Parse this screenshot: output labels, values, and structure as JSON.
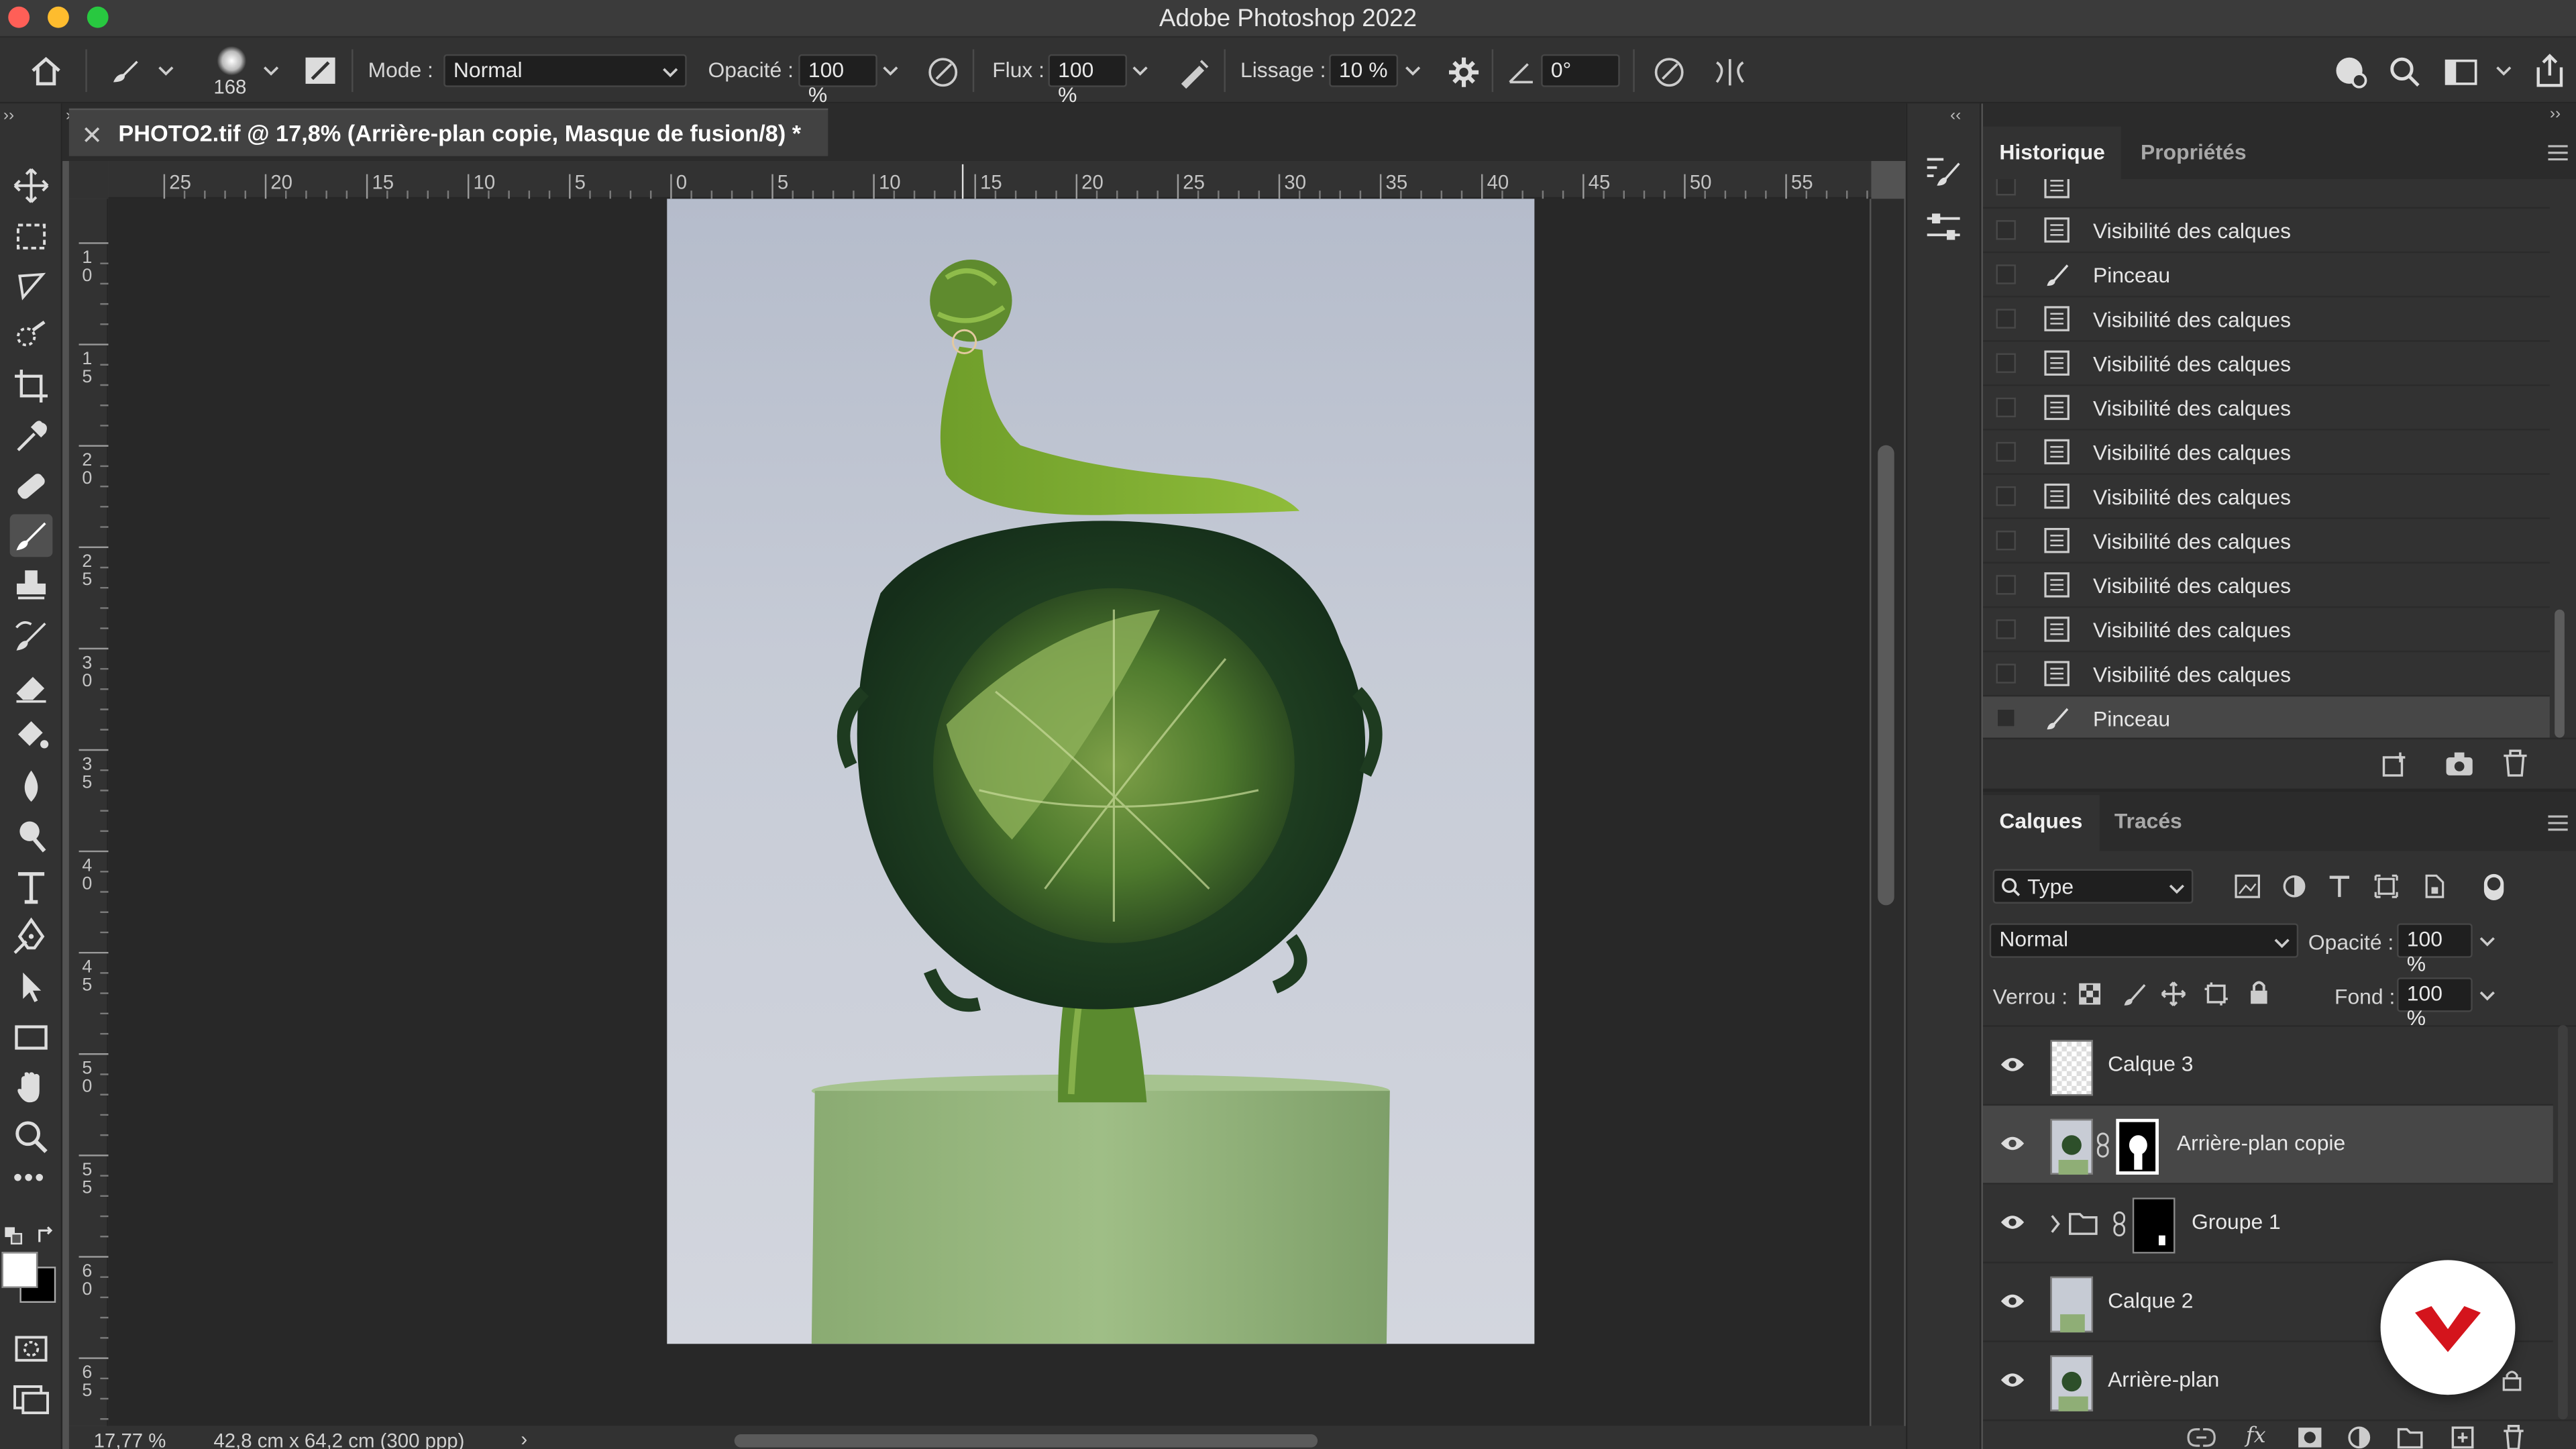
{
  "window": {
    "title": "Adobe Photoshop 2022"
  },
  "options_bar": {
    "brush_size": "168",
    "mode_label": "Mode :",
    "mode_value": "Normal",
    "opacity_label": "Opacité :",
    "opacity_value": "100 %",
    "flow_label": "Flux :",
    "flow_value": "100 %",
    "smoothing_label": "Lissage :",
    "smoothing_value": "10 %",
    "angle_value": "0°"
  },
  "document": {
    "tab_title": "PHOTO2.tif @ 17,8% (Arrière-plan copie, Masque de fusion/8) *",
    "zoom": "17,77 %",
    "dimensions": "42,8 cm x 64,2 cm (300 ppp)"
  },
  "rulers": {
    "h_labels": [
      "25",
      "20",
      "15",
      "10",
      "5",
      "0",
      "5",
      "10",
      "15",
      "20",
      "25",
      "30",
      "35",
      "40",
      "45",
      "50",
      "55"
    ],
    "v_labels": [
      "1\n0",
      "1\n5",
      "2\n0",
      "2\n5",
      "3\n0",
      "3\n5",
      "4\n0",
      "4\n5",
      "5\n0",
      "5\n5",
      "6\n0",
      "6\n5"
    ]
  },
  "history_panel": {
    "tabs": [
      "Historique",
      "Propriétés"
    ],
    "items": [
      {
        "label": "Visibilité des calques",
        "icon": "document-icon"
      },
      {
        "label": "Pinceau",
        "icon": "brush-icon"
      },
      {
        "label": "Visibilité des calques",
        "icon": "document-icon"
      },
      {
        "label": "Visibilité des calques",
        "icon": "document-icon"
      },
      {
        "label": "Visibilité des calques",
        "icon": "document-icon"
      },
      {
        "label": "Visibilité des calques",
        "icon": "document-icon"
      },
      {
        "label": "Visibilité des calques",
        "icon": "document-icon"
      },
      {
        "label": "Visibilité des calques",
        "icon": "document-icon"
      },
      {
        "label": "Visibilité des calques",
        "icon": "document-icon"
      },
      {
        "label": "Visibilité des calques",
        "icon": "document-icon"
      },
      {
        "label": "Visibilité des calques",
        "icon": "document-icon"
      },
      {
        "label": "Pinceau",
        "icon": "brush-icon",
        "selected": true
      }
    ]
  },
  "layers_panel": {
    "tabs": [
      "Calques",
      "Tracés"
    ],
    "filter_value": "Type",
    "blend_mode": "Normal",
    "opacity_label": "Opacité :",
    "opacity_value": "100 %",
    "lock_label": "Verrou :",
    "fill_label": "Fond :",
    "fill_value": "100 %",
    "layers": [
      {
        "name": "Calque 3"
      },
      {
        "name": "Arrière-plan copie",
        "selected": true
      },
      {
        "name": "Groupe 1"
      },
      {
        "name": "Calque 2"
      },
      {
        "name": "Arrière-plan"
      }
    ]
  },
  "colors": {
    "accent_red": "#d4141c",
    "canvas_bg": "#c9ccd6",
    "panel_bg": "#323232"
  }
}
